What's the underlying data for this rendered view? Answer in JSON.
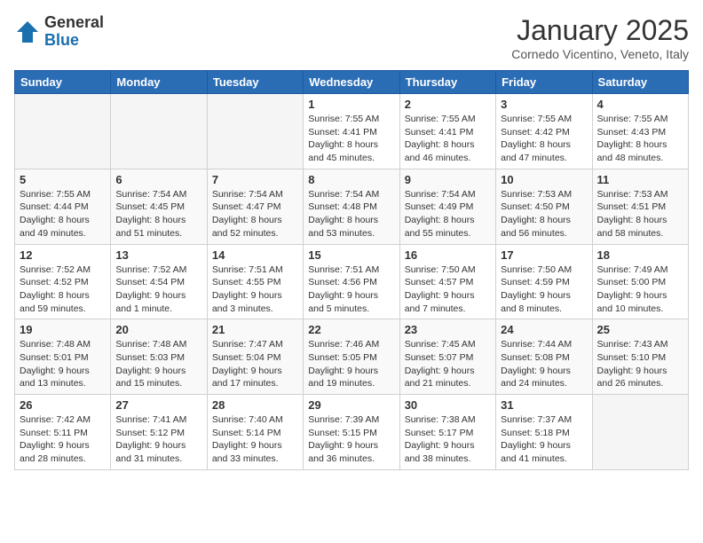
{
  "logo": {
    "general": "General",
    "blue": "Blue"
  },
  "header": {
    "month": "January 2025",
    "location": "Cornedo Vicentino, Veneto, Italy"
  },
  "weekdays": [
    "Sunday",
    "Monday",
    "Tuesday",
    "Wednesday",
    "Thursday",
    "Friday",
    "Saturday"
  ],
  "weeks": [
    [
      {
        "day": "",
        "info": ""
      },
      {
        "day": "",
        "info": ""
      },
      {
        "day": "",
        "info": ""
      },
      {
        "day": "1",
        "info": "Sunrise: 7:55 AM\nSunset: 4:41 PM\nDaylight: 8 hours and 45 minutes."
      },
      {
        "day": "2",
        "info": "Sunrise: 7:55 AM\nSunset: 4:41 PM\nDaylight: 8 hours and 46 minutes."
      },
      {
        "day": "3",
        "info": "Sunrise: 7:55 AM\nSunset: 4:42 PM\nDaylight: 8 hours and 47 minutes."
      },
      {
        "day": "4",
        "info": "Sunrise: 7:55 AM\nSunset: 4:43 PM\nDaylight: 8 hours and 48 minutes."
      }
    ],
    [
      {
        "day": "5",
        "info": "Sunrise: 7:55 AM\nSunset: 4:44 PM\nDaylight: 8 hours and 49 minutes."
      },
      {
        "day": "6",
        "info": "Sunrise: 7:54 AM\nSunset: 4:45 PM\nDaylight: 8 hours and 51 minutes."
      },
      {
        "day": "7",
        "info": "Sunrise: 7:54 AM\nSunset: 4:47 PM\nDaylight: 8 hours and 52 minutes."
      },
      {
        "day": "8",
        "info": "Sunrise: 7:54 AM\nSunset: 4:48 PM\nDaylight: 8 hours and 53 minutes."
      },
      {
        "day": "9",
        "info": "Sunrise: 7:54 AM\nSunset: 4:49 PM\nDaylight: 8 hours and 55 minutes."
      },
      {
        "day": "10",
        "info": "Sunrise: 7:53 AM\nSunset: 4:50 PM\nDaylight: 8 hours and 56 minutes."
      },
      {
        "day": "11",
        "info": "Sunrise: 7:53 AM\nSunset: 4:51 PM\nDaylight: 8 hours and 58 minutes."
      }
    ],
    [
      {
        "day": "12",
        "info": "Sunrise: 7:52 AM\nSunset: 4:52 PM\nDaylight: 8 hours and 59 minutes."
      },
      {
        "day": "13",
        "info": "Sunrise: 7:52 AM\nSunset: 4:54 PM\nDaylight: 9 hours and 1 minute."
      },
      {
        "day": "14",
        "info": "Sunrise: 7:51 AM\nSunset: 4:55 PM\nDaylight: 9 hours and 3 minutes."
      },
      {
        "day": "15",
        "info": "Sunrise: 7:51 AM\nSunset: 4:56 PM\nDaylight: 9 hours and 5 minutes."
      },
      {
        "day": "16",
        "info": "Sunrise: 7:50 AM\nSunset: 4:57 PM\nDaylight: 9 hours and 7 minutes."
      },
      {
        "day": "17",
        "info": "Sunrise: 7:50 AM\nSunset: 4:59 PM\nDaylight: 9 hours and 8 minutes."
      },
      {
        "day": "18",
        "info": "Sunrise: 7:49 AM\nSunset: 5:00 PM\nDaylight: 9 hours and 10 minutes."
      }
    ],
    [
      {
        "day": "19",
        "info": "Sunrise: 7:48 AM\nSunset: 5:01 PM\nDaylight: 9 hours and 13 minutes."
      },
      {
        "day": "20",
        "info": "Sunrise: 7:48 AM\nSunset: 5:03 PM\nDaylight: 9 hours and 15 minutes."
      },
      {
        "day": "21",
        "info": "Sunrise: 7:47 AM\nSunset: 5:04 PM\nDaylight: 9 hours and 17 minutes."
      },
      {
        "day": "22",
        "info": "Sunrise: 7:46 AM\nSunset: 5:05 PM\nDaylight: 9 hours and 19 minutes."
      },
      {
        "day": "23",
        "info": "Sunrise: 7:45 AM\nSunset: 5:07 PM\nDaylight: 9 hours and 21 minutes."
      },
      {
        "day": "24",
        "info": "Sunrise: 7:44 AM\nSunset: 5:08 PM\nDaylight: 9 hours and 24 minutes."
      },
      {
        "day": "25",
        "info": "Sunrise: 7:43 AM\nSunset: 5:10 PM\nDaylight: 9 hours and 26 minutes."
      }
    ],
    [
      {
        "day": "26",
        "info": "Sunrise: 7:42 AM\nSunset: 5:11 PM\nDaylight: 9 hours and 28 minutes."
      },
      {
        "day": "27",
        "info": "Sunrise: 7:41 AM\nSunset: 5:12 PM\nDaylight: 9 hours and 31 minutes."
      },
      {
        "day": "28",
        "info": "Sunrise: 7:40 AM\nSunset: 5:14 PM\nDaylight: 9 hours and 33 minutes."
      },
      {
        "day": "29",
        "info": "Sunrise: 7:39 AM\nSunset: 5:15 PM\nDaylight: 9 hours and 36 minutes."
      },
      {
        "day": "30",
        "info": "Sunrise: 7:38 AM\nSunset: 5:17 PM\nDaylight: 9 hours and 38 minutes."
      },
      {
        "day": "31",
        "info": "Sunrise: 7:37 AM\nSunset: 5:18 PM\nDaylight: 9 hours and 41 minutes."
      },
      {
        "day": "",
        "info": ""
      }
    ]
  ]
}
